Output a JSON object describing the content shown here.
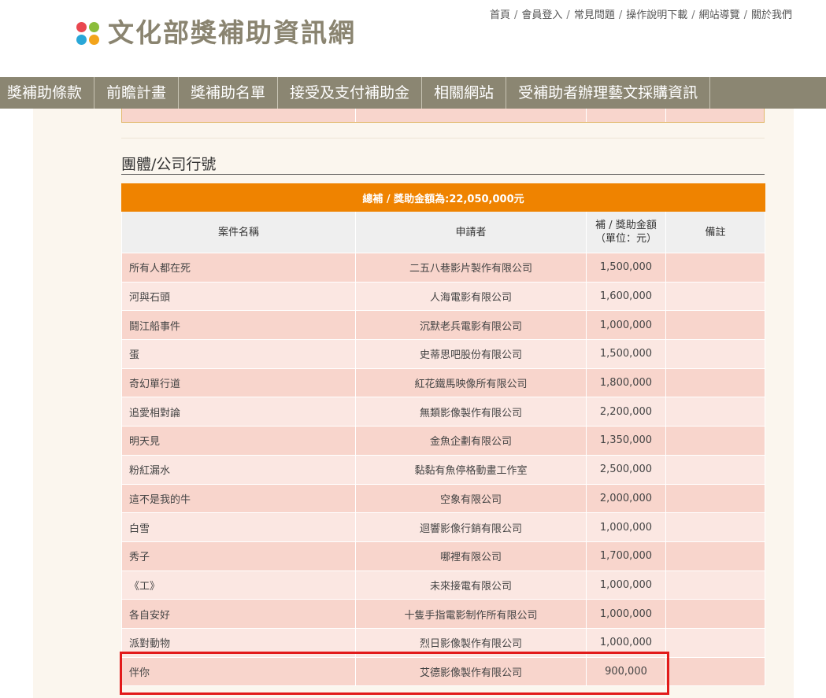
{
  "header": {
    "site_title": "文化部獎補助資訊網",
    "top_links": [
      "首頁",
      "會員登入",
      "常見問題",
      "操作說明下載",
      "網站導覽",
      "關於我們"
    ]
  },
  "nav": {
    "items": [
      "獎補助條款",
      "前瞻計畫",
      "獎補助名單",
      "接受及支付補助金",
      "相關網站",
      "受補助者辦理藝文採購資訊"
    ]
  },
  "section": {
    "title": "團體/公司行號"
  },
  "table": {
    "total_label": "總補 / 獎助金額為:22,050,000元",
    "headers": {
      "name": "案件名稱",
      "applicant": "申請者",
      "amount_line1": "補 / 獎助金額",
      "amount_line2": "（單位：元）",
      "note": "備註"
    },
    "rows": [
      {
        "name": "所有人都在死",
        "applicant": "二五八巷影片製作有限公司",
        "amount": "1,500,000"
      },
      {
        "name": "河與石頭",
        "applicant": "人海電影有限公司",
        "amount": "1,600,000"
      },
      {
        "name": "鬪江船事件",
        "applicant": "沉默老兵電影有限公司",
        "amount": "1,000,000"
      },
      {
        "name": "蛋",
        "applicant": "史蒂思吧股份有限公司",
        "amount": "1,500,000"
      },
      {
        "name": "奇幻單行道",
        "applicant": "紅花鐵馬映像所有限公司",
        "amount": "1,800,000"
      },
      {
        "name": "追愛相對論",
        "applicant": "無類影像製作有限公司",
        "amount": "2,200,000"
      },
      {
        "name": "明天見",
        "applicant": "金魚企劃有限公司",
        "amount": "1,350,000"
      },
      {
        "name": "粉紅漏水",
        "applicant": "黏黏有魚停格動畫工作室",
        "amount": "2,500,000"
      },
      {
        "name": "這不是我的牛",
        "applicant": "空象有限公司",
        "amount": "2,000,000"
      },
      {
        "name": "白雪",
        "applicant": "迴響影像行銷有限公司",
        "amount": "1,000,000"
      },
      {
        "name": "秀子",
        "applicant": "哪裡有限公司",
        "amount": "1,700,000"
      },
      {
        "name": "《工》",
        "applicant": "未來接電有限公司",
        "amount": "1,000,000"
      },
      {
        "name": "各自安好",
        "applicant": "十隻手指電影制作所有限公司",
        "amount": "1,000,000"
      },
      {
        "name": "派對動物",
        "applicant": "烈日影像製作有限公司",
        "amount": "1,000,000"
      },
      {
        "name": "伴你",
        "applicant": "艾德影像製作有限公司",
        "amount": "900,000"
      }
    ]
  },
  "colors": {
    "nav_bg": "#8b8672",
    "total_row_bg": "#ef8300",
    "row_odd_bg": "#f8d5cc",
    "row_even_bg": "#fbe7e2",
    "highlight_border": "#e21a1a"
  }
}
